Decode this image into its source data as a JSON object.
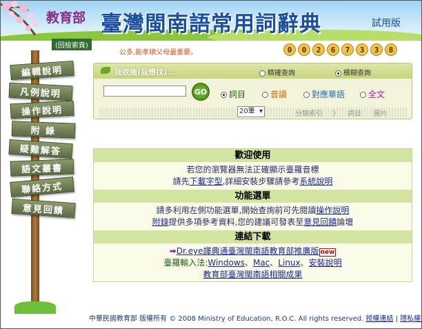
{
  "banner": {
    "ministry": "教育部",
    "title": "臺灣閩南語常用詞辭典",
    "trial": "試用版"
  },
  "back_link": "(回檢索頁)",
  "motto": "公多,能孝順父母最重要。",
  "counter": [
    "0",
    "0",
    "2",
    "6",
    "7",
    "3",
    "3",
    "8"
  ],
  "nav": [
    "編輯說明",
    "凡例說明",
    "操作說明",
    "附 錄",
    "疑難解答",
    "語文叢書",
    "聯絡方式",
    "意見回饋"
  ],
  "search": {
    "header": "我欲揣(我想找)...",
    "mode_exact": "精確查詢",
    "mode_fuzzy": "模糊查詢",
    "go": "GO",
    "fields": [
      "詞目",
      "音讀",
      "對應華語",
      "全文"
    ],
    "page_size": "20筆",
    "category_index": "分類索引",
    "arrows": "》",
    "tab_entries": "詞目",
    "tab_images": "圖片"
  },
  "info": {
    "welcome_title": "歡迎使用",
    "welcome_line1": "若您的瀏覽器無法正確顯示臺羅音標",
    "welcome_pre": "請先",
    "download_font": "下載字型",
    "welcome_mid": ",詳細安裝步驟請參考",
    "system_note": "系統說明",
    "func_title": "功能選單",
    "func_pre": "請多利用左側功能選單,開始查詢前可先閱讀",
    "operation_note": "操作說明",
    "appendix": "附錄",
    "func_mid": "提供多項參考資料,您的建議可發表至",
    "feedback": "意見回饋",
    "forum": "論壇",
    "dl_title": "連結下載",
    "drye_arrow": "➡",
    "drye": "Dr.eye譯典通臺灣閩南語教育部推廣版",
    "new_badge": "new",
    "ime_label": "臺羅輸入法:",
    "windows": "Windows",
    "sep1": "、",
    "mac": "Mac",
    "sep2": "、",
    "linux": "Linux",
    "sep3": "、",
    "install": "安裝說明",
    "results": "教育部臺灣閩南語相關成果"
  },
  "footer": {
    "copyright": "中華民國教育部 版權所有 © 2008 Ministry of Education, R.O.C. All rights reserved.",
    "license": "授權連結",
    "sep": "|",
    "privacy": "隱私權宣告"
  }
}
